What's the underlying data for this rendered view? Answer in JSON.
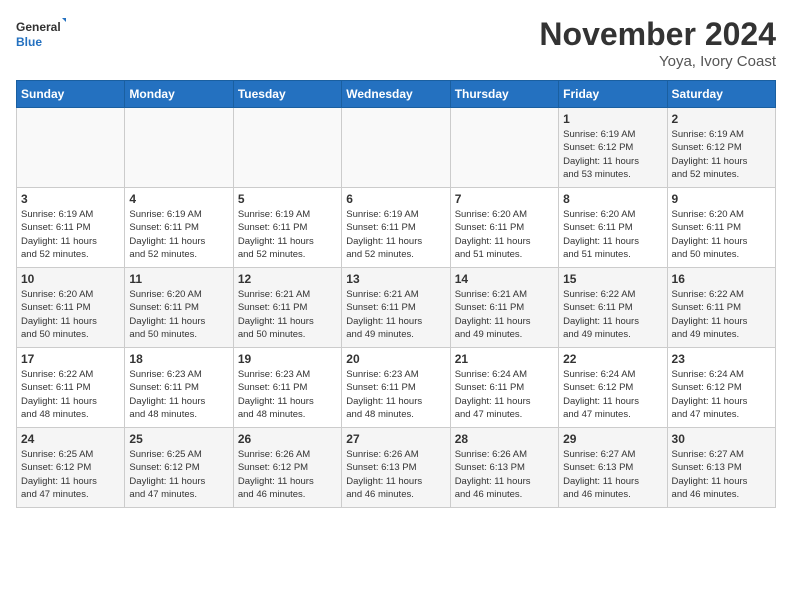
{
  "header": {
    "logo_line1": "General",
    "logo_line2": "Blue",
    "title": "November 2024",
    "subtitle": "Yoya, Ivory Coast"
  },
  "weekdays": [
    "Sunday",
    "Monday",
    "Tuesday",
    "Wednesday",
    "Thursday",
    "Friday",
    "Saturday"
  ],
  "weeks": [
    [
      {
        "day": "",
        "info": ""
      },
      {
        "day": "",
        "info": ""
      },
      {
        "day": "",
        "info": ""
      },
      {
        "day": "",
        "info": ""
      },
      {
        "day": "",
        "info": ""
      },
      {
        "day": "1",
        "info": "Sunrise: 6:19 AM\nSunset: 6:12 PM\nDaylight: 11 hours\nand 53 minutes."
      },
      {
        "day": "2",
        "info": "Sunrise: 6:19 AM\nSunset: 6:12 PM\nDaylight: 11 hours\nand 52 minutes."
      }
    ],
    [
      {
        "day": "3",
        "info": "Sunrise: 6:19 AM\nSunset: 6:11 PM\nDaylight: 11 hours\nand 52 minutes."
      },
      {
        "day": "4",
        "info": "Sunrise: 6:19 AM\nSunset: 6:11 PM\nDaylight: 11 hours\nand 52 minutes."
      },
      {
        "day": "5",
        "info": "Sunrise: 6:19 AM\nSunset: 6:11 PM\nDaylight: 11 hours\nand 52 minutes."
      },
      {
        "day": "6",
        "info": "Sunrise: 6:19 AM\nSunset: 6:11 PM\nDaylight: 11 hours\nand 52 minutes."
      },
      {
        "day": "7",
        "info": "Sunrise: 6:20 AM\nSunset: 6:11 PM\nDaylight: 11 hours\nand 51 minutes."
      },
      {
        "day": "8",
        "info": "Sunrise: 6:20 AM\nSunset: 6:11 PM\nDaylight: 11 hours\nand 51 minutes."
      },
      {
        "day": "9",
        "info": "Sunrise: 6:20 AM\nSunset: 6:11 PM\nDaylight: 11 hours\nand 50 minutes."
      }
    ],
    [
      {
        "day": "10",
        "info": "Sunrise: 6:20 AM\nSunset: 6:11 PM\nDaylight: 11 hours\nand 50 minutes."
      },
      {
        "day": "11",
        "info": "Sunrise: 6:20 AM\nSunset: 6:11 PM\nDaylight: 11 hours\nand 50 minutes."
      },
      {
        "day": "12",
        "info": "Sunrise: 6:21 AM\nSunset: 6:11 PM\nDaylight: 11 hours\nand 50 minutes."
      },
      {
        "day": "13",
        "info": "Sunrise: 6:21 AM\nSunset: 6:11 PM\nDaylight: 11 hours\nand 49 minutes."
      },
      {
        "day": "14",
        "info": "Sunrise: 6:21 AM\nSunset: 6:11 PM\nDaylight: 11 hours\nand 49 minutes."
      },
      {
        "day": "15",
        "info": "Sunrise: 6:22 AM\nSunset: 6:11 PM\nDaylight: 11 hours\nand 49 minutes."
      },
      {
        "day": "16",
        "info": "Sunrise: 6:22 AM\nSunset: 6:11 PM\nDaylight: 11 hours\nand 49 minutes."
      }
    ],
    [
      {
        "day": "17",
        "info": "Sunrise: 6:22 AM\nSunset: 6:11 PM\nDaylight: 11 hours\nand 48 minutes."
      },
      {
        "day": "18",
        "info": "Sunrise: 6:23 AM\nSunset: 6:11 PM\nDaylight: 11 hours\nand 48 minutes."
      },
      {
        "day": "19",
        "info": "Sunrise: 6:23 AM\nSunset: 6:11 PM\nDaylight: 11 hours\nand 48 minutes."
      },
      {
        "day": "20",
        "info": "Sunrise: 6:23 AM\nSunset: 6:11 PM\nDaylight: 11 hours\nand 48 minutes."
      },
      {
        "day": "21",
        "info": "Sunrise: 6:24 AM\nSunset: 6:11 PM\nDaylight: 11 hours\nand 47 minutes."
      },
      {
        "day": "22",
        "info": "Sunrise: 6:24 AM\nSunset: 6:12 PM\nDaylight: 11 hours\nand 47 minutes."
      },
      {
        "day": "23",
        "info": "Sunrise: 6:24 AM\nSunset: 6:12 PM\nDaylight: 11 hours\nand 47 minutes."
      }
    ],
    [
      {
        "day": "24",
        "info": "Sunrise: 6:25 AM\nSunset: 6:12 PM\nDaylight: 11 hours\nand 47 minutes."
      },
      {
        "day": "25",
        "info": "Sunrise: 6:25 AM\nSunset: 6:12 PM\nDaylight: 11 hours\nand 47 minutes."
      },
      {
        "day": "26",
        "info": "Sunrise: 6:26 AM\nSunset: 6:12 PM\nDaylight: 11 hours\nand 46 minutes."
      },
      {
        "day": "27",
        "info": "Sunrise: 6:26 AM\nSunset: 6:13 PM\nDaylight: 11 hours\nand 46 minutes."
      },
      {
        "day": "28",
        "info": "Sunrise: 6:26 AM\nSunset: 6:13 PM\nDaylight: 11 hours\nand 46 minutes."
      },
      {
        "day": "29",
        "info": "Sunrise: 6:27 AM\nSunset: 6:13 PM\nDaylight: 11 hours\nand 46 minutes."
      },
      {
        "day": "30",
        "info": "Sunrise: 6:27 AM\nSunset: 6:13 PM\nDaylight: 11 hours\nand 46 minutes."
      }
    ]
  ]
}
